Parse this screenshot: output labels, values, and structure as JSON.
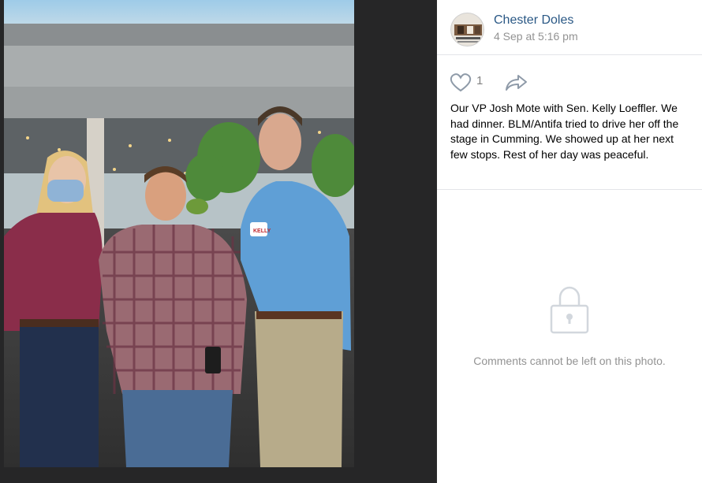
{
  "post": {
    "author": "Chester Doles",
    "date": "4 Sep at 5:16 pm",
    "likes": "1",
    "caption": "Our VP Josh Mote with Sen. Kelly Loeffler. We had dinner. BLM/Antifa tried to drive her off the stage in Cumming. We showed up at her next few stops. Rest of her day was peaceful."
  },
  "comments": {
    "closed_message": "Comments cannot be left on this photo."
  },
  "photo": {
    "sign_text": "KELLY"
  },
  "icons": {
    "like": "heart-icon",
    "share": "share-arrow-icon",
    "lock": "lock-icon"
  },
  "colors": {
    "author_link": "#2a5885",
    "muted": "#939393",
    "divider": "#e3e4e8"
  }
}
